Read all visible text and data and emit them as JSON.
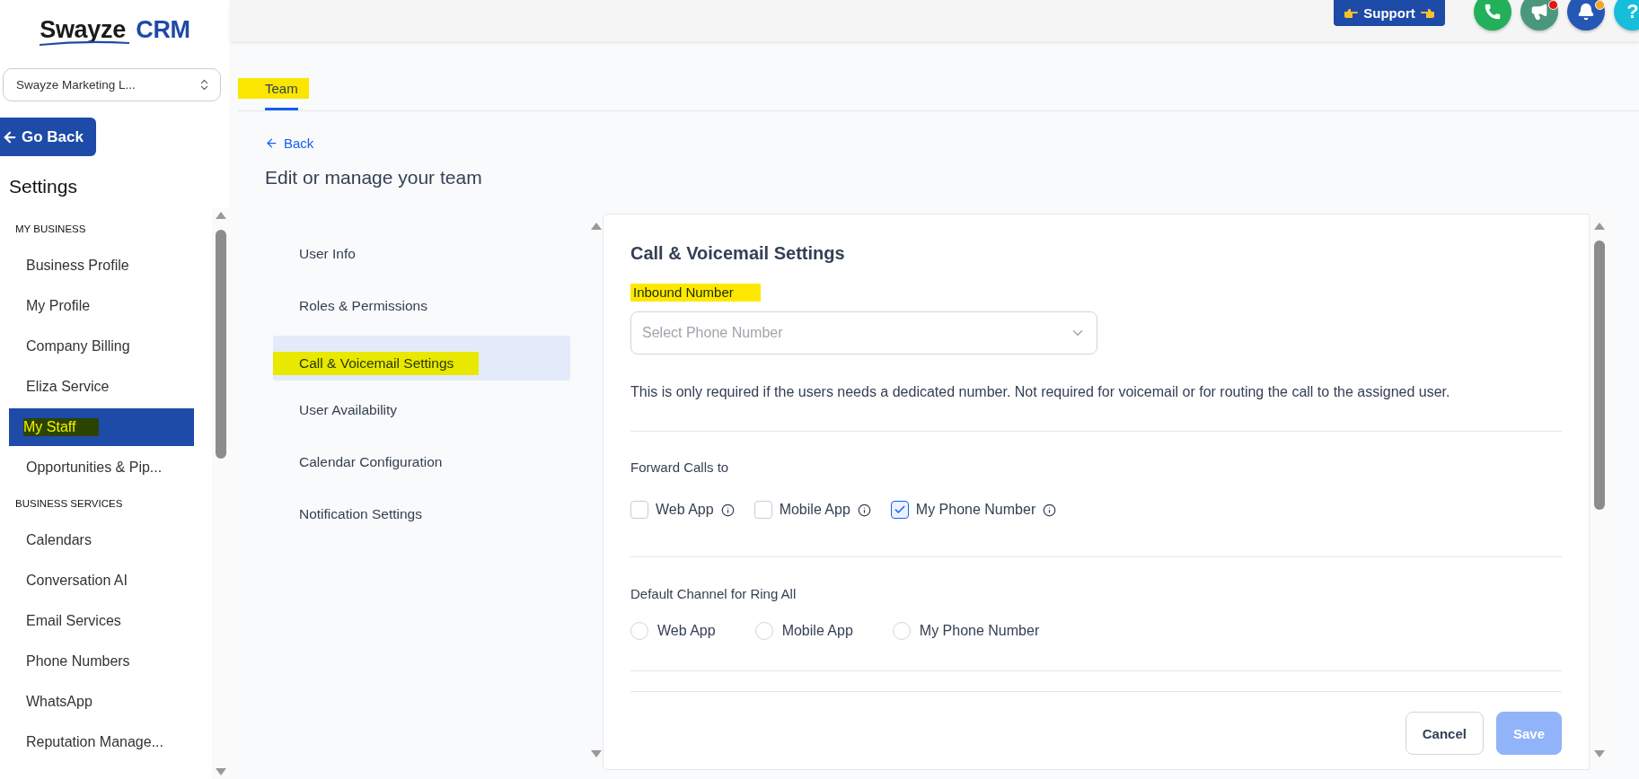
{
  "logo": {
    "word1": "Swayze",
    "word2": "CRM"
  },
  "account_select": {
    "value": "Swayze Marketing L..."
  },
  "go_back": {
    "label": "Go Back"
  },
  "sidebar": {
    "title": "Settings",
    "sections": [
      {
        "heading": "MY BUSINESS",
        "items": [
          {
            "label": "Business Profile",
            "selected": false,
            "highlighted": false
          },
          {
            "label": "My Profile",
            "selected": false,
            "highlighted": false
          },
          {
            "label": "Company Billing",
            "selected": false,
            "highlighted": false
          },
          {
            "label": "Eliza Service",
            "selected": false,
            "highlighted": false
          },
          {
            "label": "My Staff",
            "selected": true,
            "highlighted": true
          },
          {
            "label": "Opportunities & Pip...",
            "selected": false,
            "highlighted": false
          }
        ]
      },
      {
        "heading": "BUSINESS SERVICES",
        "items": [
          {
            "label": "Calendars",
            "selected": false,
            "highlighted": false
          },
          {
            "label": "Conversation AI",
            "selected": false,
            "highlighted": false
          },
          {
            "label": "Email Services",
            "selected": false,
            "highlighted": false
          },
          {
            "label": "Phone Numbers",
            "selected": false,
            "highlighted": false
          },
          {
            "label": "WhatsApp",
            "selected": false,
            "highlighted": false
          },
          {
            "label": "Reputation Manage...",
            "selected": false,
            "highlighted": false
          }
        ]
      }
    ]
  },
  "header": {
    "support": {
      "label": "Support"
    },
    "actions": [
      {
        "kind": "phone",
        "color": "#22b05a"
      },
      {
        "kind": "megaphone",
        "color": "#4a977c",
        "dot": {
          "color": "#ee1111"
        }
      },
      {
        "kind": "bell",
        "color": "#2557b5",
        "dot": {
          "color": "#f5a623"
        }
      },
      {
        "kind": "help",
        "color": "#17bedb",
        "label": "?"
      }
    ]
  },
  "tabs": [
    {
      "label": "Team",
      "selected": true,
      "highlighted": true
    }
  ],
  "back_link": "Back",
  "page_title": "Edit or manage your team",
  "nav": [
    {
      "label": "User Info",
      "selected": false,
      "highlighted": false
    },
    {
      "label": "Roles & Permissions",
      "selected": false,
      "highlighted": false
    },
    {
      "label": "Call & Voicemail Settings",
      "selected": true,
      "highlighted": true
    },
    {
      "label": "User Availability",
      "selected": false,
      "highlighted": false
    },
    {
      "label": "Calendar Configuration",
      "selected": false,
      "highlighted": false
    },
    {
      "label": "Notification Settings",
      "selected": false,
      "highlighted": false
    }
  ],
  "card": {
    "title": "Call & Voicemail Settings",
    "inbound": {
      "label": "Inbound Number",
      "highlighted": true,
      "placeholder": "Select Phone Number",
      "help": "This is only required if the users needs a dedicated number. Not required for voicemail or for routing the call to the assigned user."
    },
    "forward": {
      "label": "Forward Calls to",
      "options": [
        {
          "label": "Web App",
          "checked": false
        },
        {
          "label": "Mobile App",
          "checked": false
        },
        {
          "label": "My Phone Number",
          "checked": true
        }
      ]
    },
    "ring_all": {
      "label": "Default Channel for Ring All",
      "options": [
        {
          "label": "Web App",
          "selected": false
        },
        {
          "label": "Mobile App",
          "selected": false
        },
        {
          "label": "My Phone Number",
          "selected": false
        }
      ]
    },
    "buttons": [
      {
        "label": "Cancel",
        "kind": "secondary"
      },
      {
        "label": "Save",
        "kind": "primary",
        "disabled": true
      }
    ]
  }
}
